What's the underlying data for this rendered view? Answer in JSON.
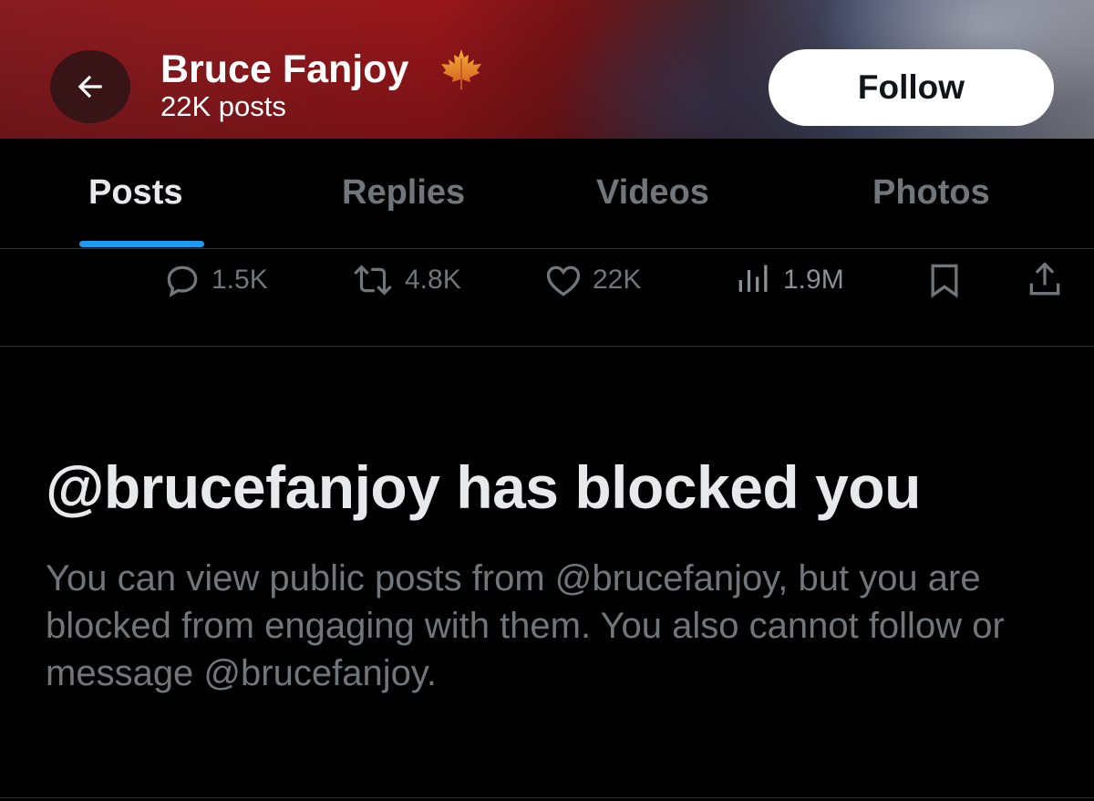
{
  "header": {
    "name": "Bruce Fanjoy",
    "name_emoji_icon": "maple-leaf-icon",
    "post_count": "22K posts",
    "follow_label": "Follow",
    "back_icon": "back-arrow-icon",
    "colors": {
      "banner_left": "#9b1b1f",
      "banner_right": "#8a8c96",
      "follow_bg": "#ffffff",
      "follow_text": "#0f1419"
    }
  },
  "tabs": [
    {
      "label": "Posts",
      "active": true
    },
    {
      "label": "Replies",
      "active": false
    },
    {
      "label": "Videos",
      "active": false
    },
    {
      "label": "Photos",
      "active": false
    }
  ],
  "tab_indicator_color": "#1d9bf0",
  "actions": {
    "replies": {
      "icon": "reply-icon",
      "count": "1.5K"
    },
    "reposts": {
      "icon": "repost-icon",
      "count": "4.8K"
    },
    "likes": {
      "icon": "heart-icon",
      "count": "22K"
    },
    "views": {
      "icon": "views-icon",
      "count": "1.9M"
    },
    "bookmark": {
      "icon": "bookmark-icon"
    },
    "share": {
      "icon": "share-icon"
    }
  },
  "blocked": {
    "title": "@brucefanjoy has blocked you",
    "description": "You can view public posts from @brucefanjoy, but you are blocked from engaging with them. You also cannot follow or message @brucefanjoy."
  }
}
